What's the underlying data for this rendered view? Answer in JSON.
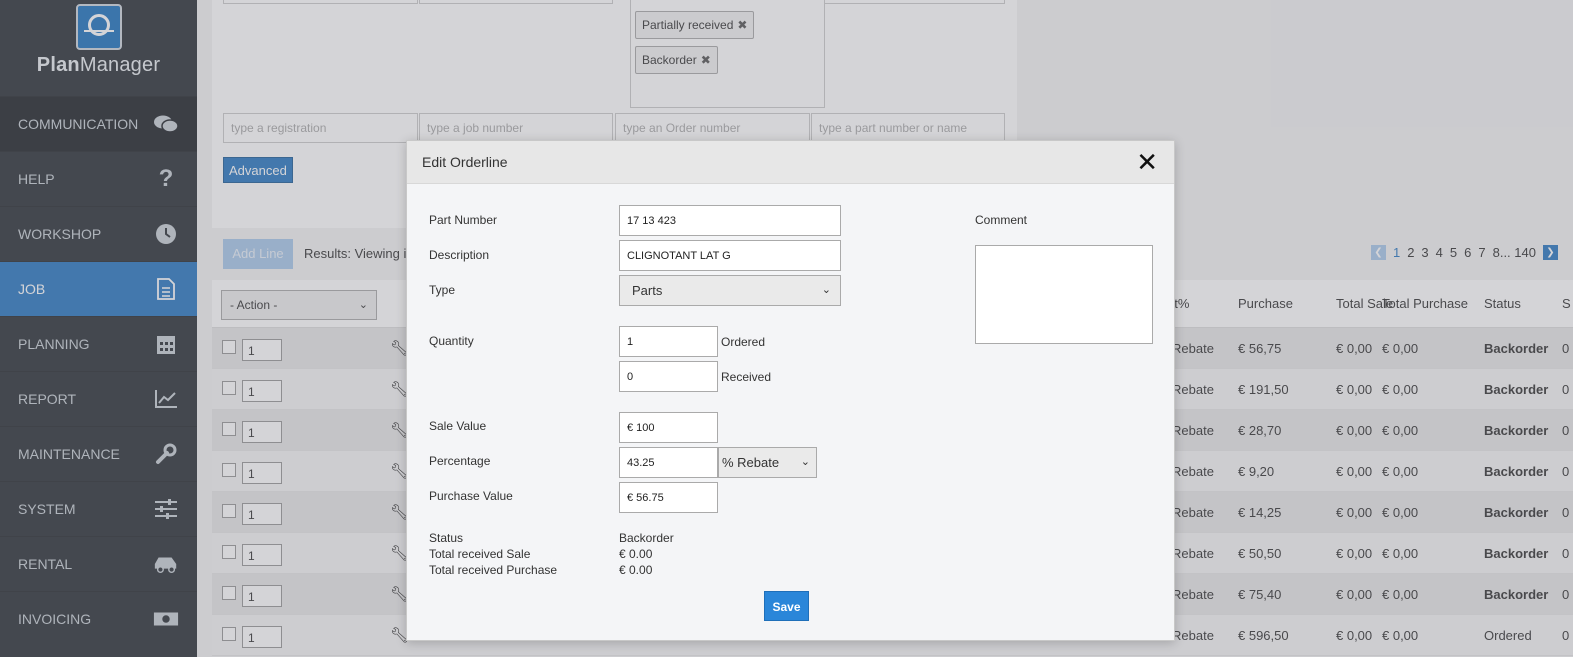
{
  "app": {
    "logo_bold": "Plan",
    "logo_rest": "Manager"
  },
  "sidebar": {
    "items": [
      {
        "label": "COMMUNICATION",
        "icon": "chat-icon"
      },
      {
        "label": "HELP",
        "icon": "question-icon"
      },
      {
        "label": "WORKSHOP",
        "icon": "clock-icon"
      },
      {
        "label": "JOB",
        "icon": "document-icon"
      },
      {
        "label": "PLANNING",
        "icon": "calendar-icon"
      },
      {
        "label": "REPORT",
        "icon": "chart-icon"
      },
      {
        "label": "MAINTENANCE",
        "icon": "wrench-icon"
      },
      {
        "label": "SYSTEM",
        "icon": "sliders-icon"
      },
      {
        "label": "RENTAL",
        "icon": "car-icon"
      },
      {
        "label": "INVOICING",
        "icon": "money-icon"
      }
    ],
    "active": "JOB",
    "accent": "#2a78c2"
  },
  "filters": {
    "status_chips": [
      "Partially received",
      "Backorder"
    ],
    "registration_placeholder": "type a registration",
    "job_placeholder": "type a job number",
    "order_placeholder": "type an Order number",
    "part_placeholder": "type a part number or name",
    "advanced_label": "Advanced"
  },
  "toolbar": {
    "add_line_label": "Add Line",
    "results_text": "Results: Viewing ite",
    "pages": [
      "1",
      "2",
      "3",
      "4",
      "5",
      "6",
      "7",
      "8",
      "...",
      "140"
    ]
  },
  "table": {
    "action_label": "- Action -",
    "headers": {
      "pct": "nt%",
      "purchase": "Purchase",
      "total_sale": "Total Sale",
      "total_purchase": "Total Purchase",
      "status": "Status",
      "extra": "S"
    },
    "rows": [
      {
        "qty": "1",
        "pct": "Rebate",
        "purchase": "€ 56,75",
        "total_sale": "€ 0,00",
        "total_purchase": "€ 0,00",
        "status": "Backorder",
        "extra": "0"
      },
      {
        "qty": "1",
        "pct": "Rebate",
        "purchase": "€ 191,50",
        "total_sale": "€ 0,00",
        "total_purchase": "€ 0,00",
        "status": "Backorder",
        "extra": "0"
      },
      {
        "qty": "1",
        "pct": "Rebate",
        "purchase": "€ 28,70",
        "total_sale": "€ 0,00",
        "total_purchase": "€ 0,00",
        "status": "Backorder",
        "extra": "0"
      },
      {
        "qty": "1",
        "pct": "Rebate",
        "purchase": "€ 9,20",
        "total_sale": "€ 0,00",
        "total_purchase": "€ 0,00",
        "status": "Backorder",
        "extra": "0"
      },
      {
        "qty": "1",
        "pct": "Rebate",
        "purchase": "€ 14,25",
        "total_sale": "€ 0,00",
        "total_purchase": "€ 0,00",
        "status": "Backorder",
        "extra": "0"
      },
      {
        "qty": "1",
        "pct": "Rebate",
        "purchase": "€ 50,50",
        "total_sale": "€ 0,00",
        "total_purchase": "€ 0,00",
        "status": "Backorder",
        "extra": "0"
      },
      {
        "qty": "1",
        "pct": "Rebate",
        "purchase": "€ 75,40",
        "total_sale": "€ 0,00",
        "total_purchase": "€ 0,00",
        "status": "Backorder",
        "extra": "0"
      },
      {
        "qty": "1",
        "pct": "Rebate",
        "purchase": "€ 596,50",
        "total_sale": "€ 0,00",
        "total_purchase": "€ 0,00",
        "status": "Ordered",
        "extra": "0"
      }
    ]
  },
  "modal": {
    "title": "Edit Orderline",
    "part_number_label": "Part Number",
    "part_number": "17 13 423",
    "description_label": "Description",
    "description": "CLIGNOTANT LAT G",
    "type_label": "Type",
    "type_value": "Parts",
    "quantity_label": "Quantity",
    "ordered_value": "1",
    "ordered_label": "Ordered",
    "received_value": "0",
    "received_label": "Received",
    "sale_value_label": "Sale Value",
    "sale_value": "€  100",
    "percentage_label": "Percentage",
    "percentage_value": "43.25",
    "percentage_type": "% Rebate",
    "purchase_value_label": "Purchase Value",
    "purchase_value": "€  56.75",
    "status_label": "Status",
    "status_value": "Backorder",
    "total_sale_label": "Total received Sale",
    "total_sale_value": "€ 0.00",
    "total_purchase_label": "Total received Purchase",
    "total_purchase_value": "€ 0.00",
    "comment_label": "Comment",
    "save_label": "Save"
  }
}
